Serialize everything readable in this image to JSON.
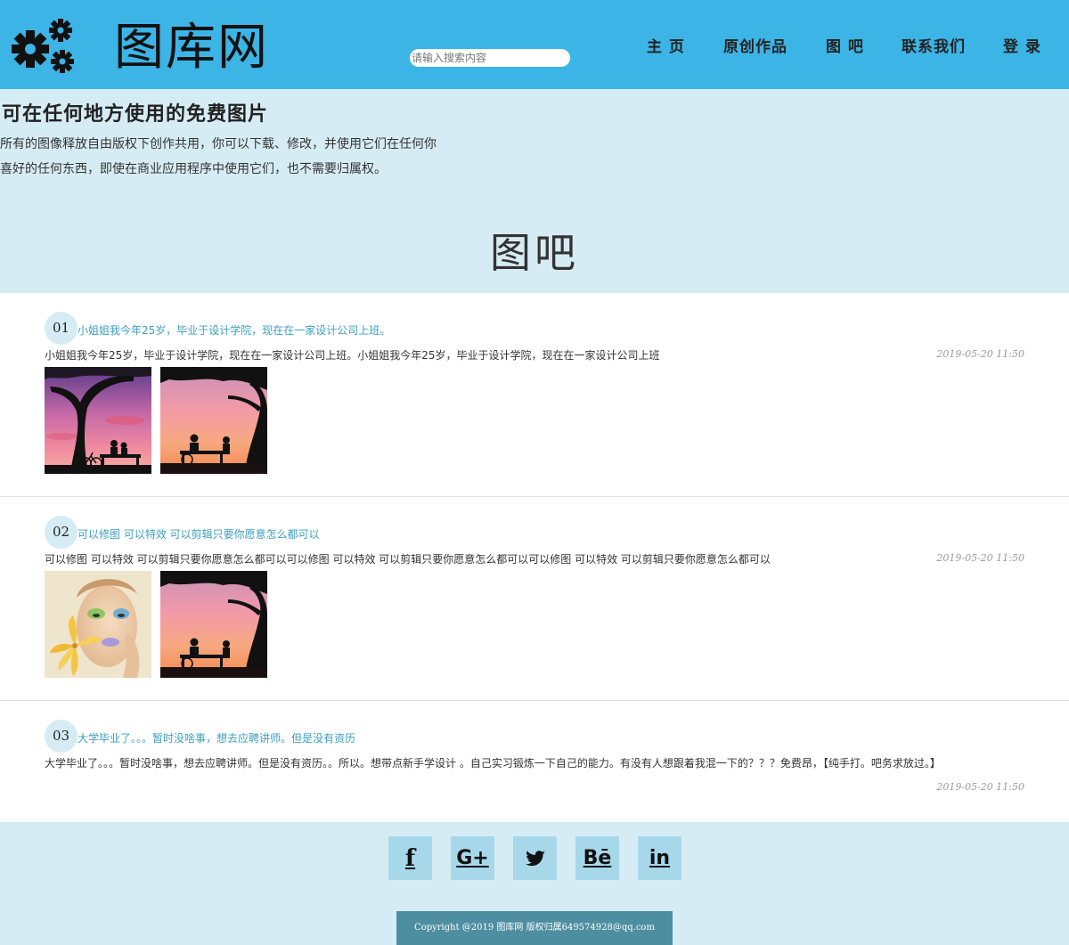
{
  "header": {
    "logo_text": "图库网",
    "logo_icon": "gears-icon",
    "search_placeholder": "请输入搜索内容",
    "nav": [
      "主 页",
      "原创作品",
      "图 吧",
      "联系我们",
      "登 录"
    ],
    "colors": {
      "header_bg": "#3cb4e6",
      "band_bg": "#d6ecf4",
      "accent_text": "#3b9fbf"
    }
  },
  "intro": {
    "title": "可在任何地方使用的免费图片",
    "desc_line1": "所有的图像释放自由版权下创作共用，你可以下载、修改，并使用它们在任何你",
    "desc_line2": "喜好的任何东西，即使在商业应用程序中使用它们，也不需要归属权。"
  },
  "section_title": "图吧",
  "posts": [
    {
      "num": "01",
      "title": "小姐姐我今年25岁，毕业于设计学院，现在在一家设计公司上班。",
      "body": "小姐姐我今年25岁，毕业于设计学院，现在在一家设计公司上班。小姐姐我今年25岁，毕业于设计学院，现在在一家设计公司上班",
      "date": "2019-05-20 11:50",
      "images": [
        "sunset-couple-bench-purple",
        "sunset-couple-bench-orange"
      ]
    },
    {
      "num": "02",
      "title": "可以修图 可以特效 可以剪辑只要你愿意怎么都可以",
      "body": "可以修图 可以特效 可以剪辑只要你愿意怎么都可以可以修图 可以特效 可以剪辑只要你愿意怎么都可以可以修图 可以特效 可以剪辑只要你愿意怎么都可以",
      "date": "2019-05-20 11:50",
      "images": [
        "woman-flower-makeup",
        "sunset-couple-bench-orange"
      ]
    },
    {
      "num": "03",
      "title": "大学毕业了。。。暂时没啥事，想去应聘讲师。但是没有资历",
      "body": "大学毕业了。。。暂时没啥事，想去应聘讲师。但是没有资历。。所以。想带点新手学设计 。自己实习锻炼一下自己的能力。有没有人想跟着我混一下的？？？免费昂，【纯手打。吧务求放过。】",
      "date": "2019-05-20 11:50",
      "images": []
    }
  ],
  "footer": {
    "social": [
      {
        "icon": "facebook-icon",
        "glyph": "f"
      },
      {
        "icon": "google-plus-icon",
        "glyph": "G+"
      },
      {
        "icon": "twitter-icon",
        "glyph": ""
      },
      {
        "icon": "behance-icon",
        "glyph": "Bē"
      },
      {
        "icon": "linkedin-icon",
        "glyph": "in"
      }
    ],
    "copyright": "Copyright @2019 图库网 版权归属649574928@qq.com"
  }
}
